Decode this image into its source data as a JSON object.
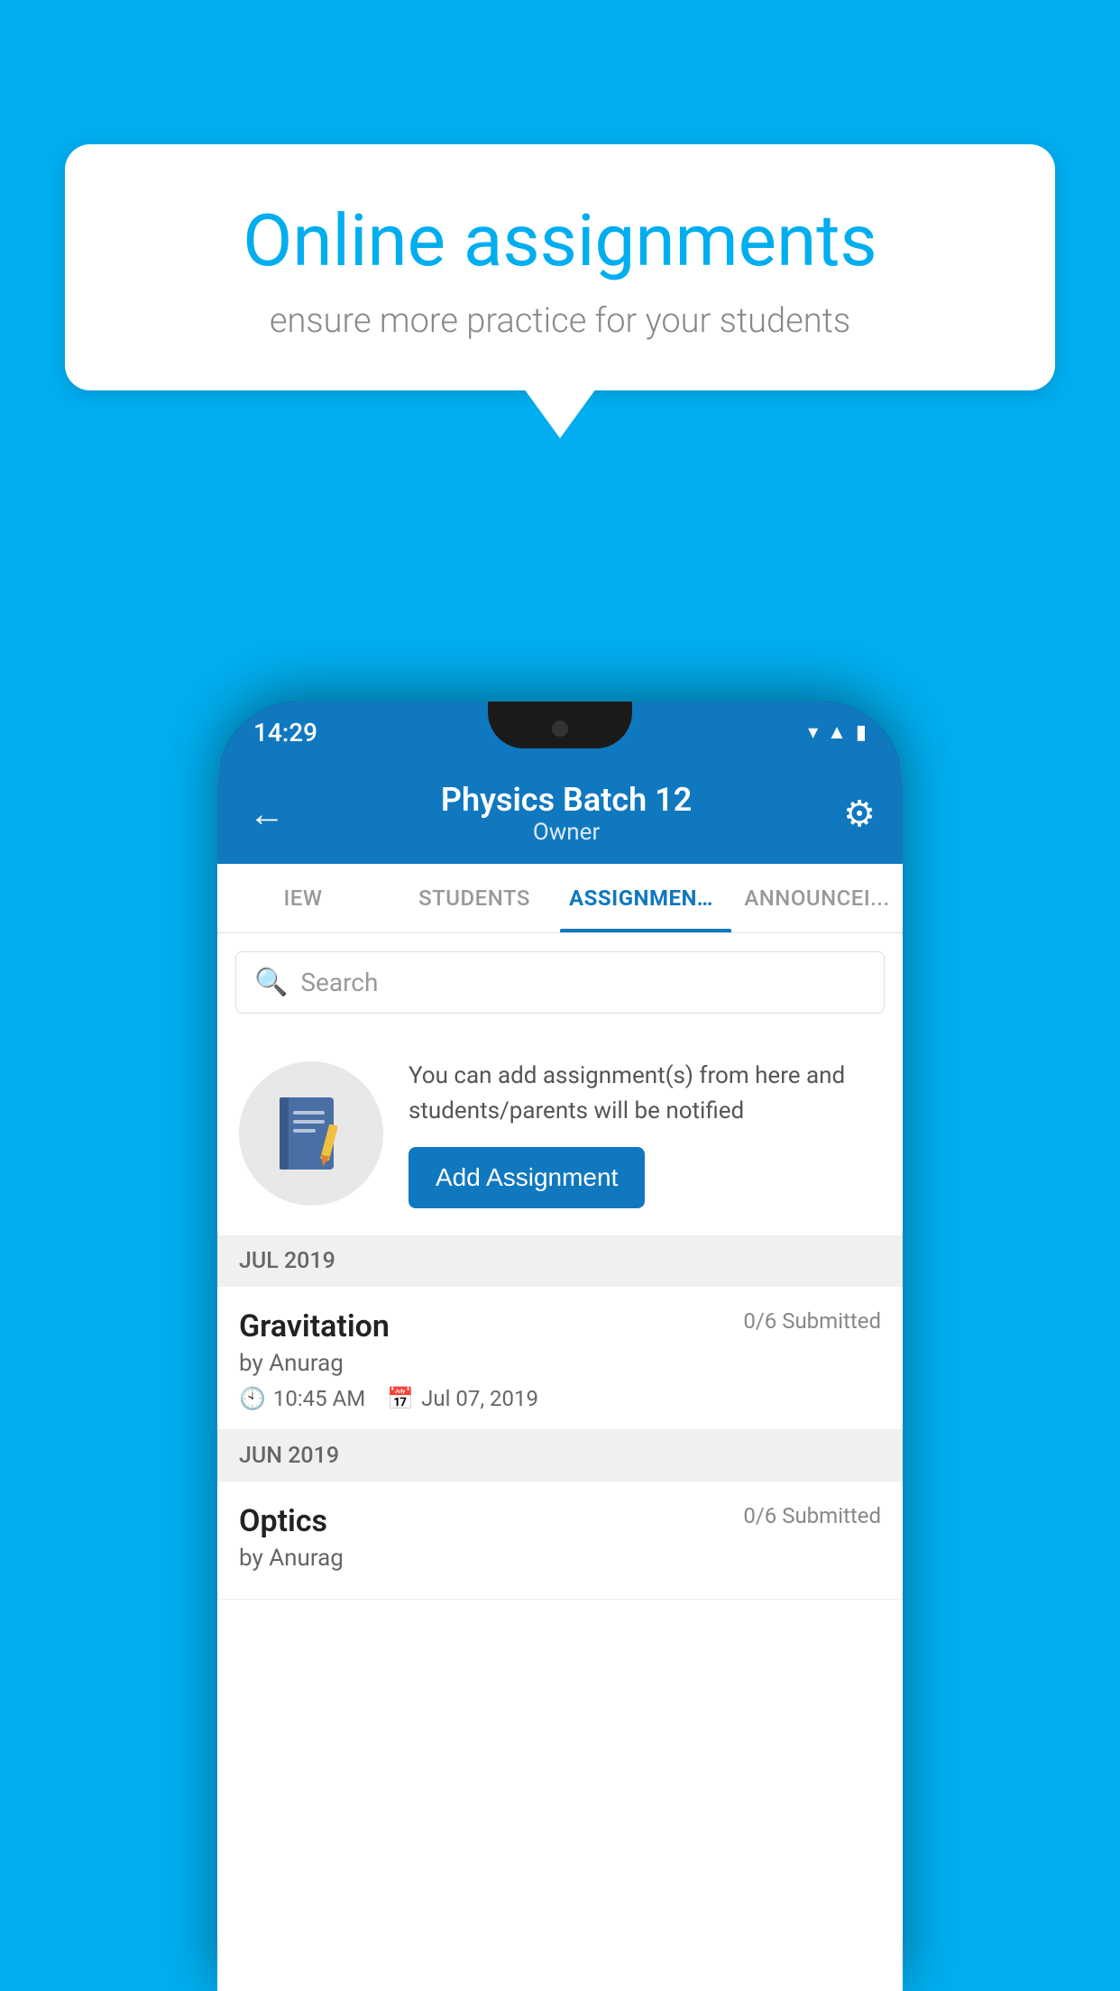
{
  "background": {
    "color": "#00AEEF"
  },
  "speech_bubble": {
    "title": "Online assignments",
    "subtitle": "ensure more practice for your students"
  },
  "phone": {
    "status_bar": {
      "time": "14:29"
    },
    "header": {
      "title": "Physics Batch 12",
      "subtitle": "Owner",
      "back_label": "←",
      "gear_label": "⚙"
    },
    "tabs": [
      {
        "label": "IEW",
        "active": false
      },
      {
        "label": "STUDENTS",
        "active": false
      },
      {
        "label": "ASSIGNMENTS",
        "active": true
      },
      {
        "label": "ANNOUNCEMENTS",
        "active": false
      }
    ],
    "search": {
      "placeholder": "Search"
    },
    "info_card": {
      "text": "You can add assignment(s) from here and students/parents will be notified",
      "button_label": "Add Assignment"
    },
    "sections": [
      {
        "header": "JUL 2019",
        "assignments": [
          {
            "name": "Gravitation",
            "submitted": "0/6 Submitted",
            "by": "by Anurag",
            "time": "10:45 AM",
            "date": "Jul 07, 2019"
          }
        ]
      },
      {
        "header": "JUN 2019",
        "assignments": [
          {
            "name": "Optics",
            "submitted": "0/6 Submitted",
            "by": "by Anurag",
            "time": "",
            "date": ""
          }
        ]
      }
    ]
  }
}
